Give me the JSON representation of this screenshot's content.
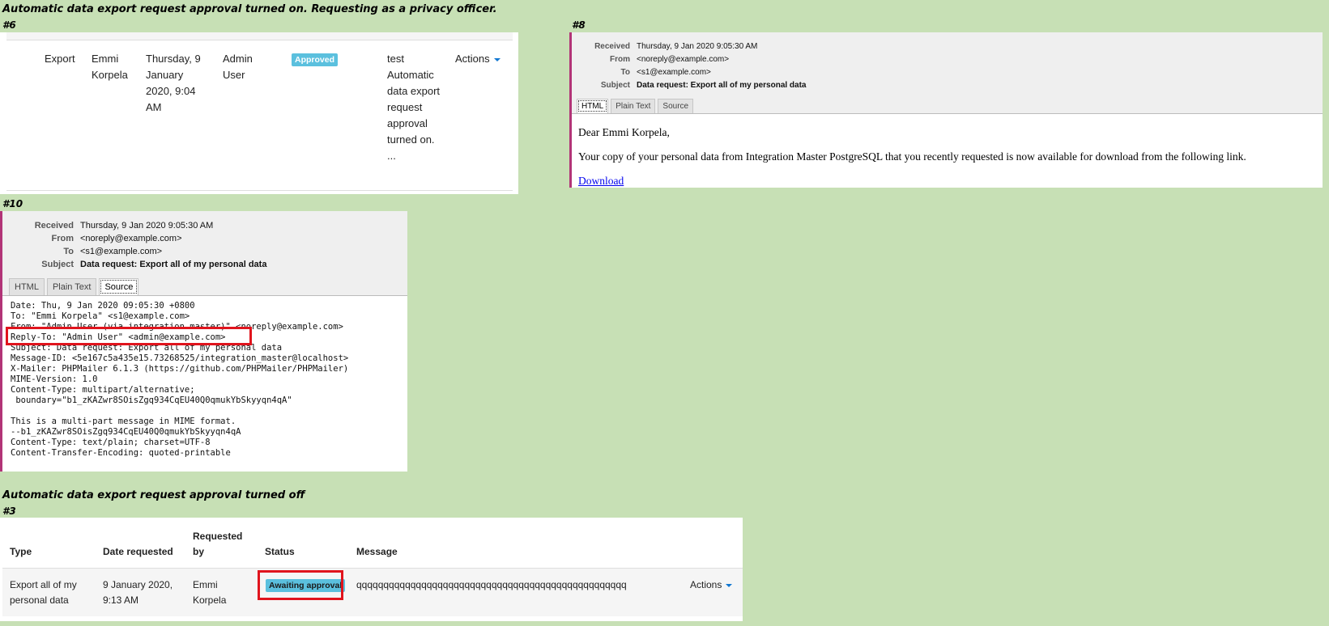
{
  "captions": {
    "top": "Automatic data export request approval turned on. Requesting as a privacy officer.",
    "bottom": "Automatic data export request approval turned off"
  },
  "labels": {
    "p6": "#6",
    "m8": "#8",
    "m10": "#10",
    "p3": "#3"
  },
  "panel6": {
    "type": "Export",
    "user": "Emmi Korpela",
    "date": "Thursday, 9 January 2020, 9:04 AM",
    "requested_by": "Admin User",
    "status": "Approved",
    "message": "test Automatic data export request approval turned on. ...",
    "actions": "Actions"
  },
  "mail8": {
    "header": [
      {
        "k": "Received",
        "v": "Thursday, 9 Jan 2020 9:05:30 AM"
      },
      {
        "k": "From",
        "v": "<noreply@example.com>"
      },
      {
        "k": "To",
        "v": "<s1@example.com>"
      },
      {
        "k": "Subject",
        "v": "Data request: Export all of my personal data"
      }
    ],
    "tabs": [
      "HTML",
      "Plain Text",
      "Source"
    ],
    "active_tab": "HTML",
    "greeting": "Dear Emmi Korpela,",
    "text": "Your copy of your personal data from Integration Master PostgreSQL that you recently requested is now available for download from the following link.",
    "link": "Download"
  },
  "mail10": {
    "header": [
      {
        "k": "Received",
        "v": "Thursday, 9 Jan 2020 9:05:30 AM"
      },
      {
        "k": "From",
        "v": "<noreply@example.com>"
      },
      {
        "k": "To",
        "v": "<s1@example.com>"
      },
      {
        "k": "Subject",
        "v": "Data request: Export all of my personal data"
      }
    ],
    "tabs": [
      "HTML",
      "Plain Text",
      "Source"
    ],
    "active_tab": "Source",
    "source": "Date: Thu, 9 Jan 2020 09:05:30 +0800\nTo: \"Emmi Korpela\" <s1@example.com>\nFrom: \"Admin User (via integration master)\" <noreply@example.com>\nReply-To: \"Admin User\" <admin@example.com>\nSubject: Data request: Export all of my personal data\nMessage-ID: <5e167c5a435e15.73268525/integration_master@localhost>\nX-Mailer: PHPMailer 6.1.3 (https://github.com/PHPMailer/PHPMailer)\nMIME-Version: 1.0\nContent-Type: multipart/alternative;\n boundary=\"b1_zKAZwr8SOisZgq934CqEU40Q0qmukYbSkyyqn4qA\"\n\nThis is a multi-part message in MIME format.\n--b1_zKAZwr8SOisZgq934CqEU40Q0qmukYbSkyyqn4qA\nContent-Type: text/plain; charset=UTF-8\nContent-Transfer-Encoding: quoted-printable"
  },
  "panel3": {
    "headers": {
      "type": "Type",
      "date": "Date requested",
      "requested_by": "Requested by",
      "status": "Status",
      "message": "Message"
    },
    "row": {
      "type": "Export all of my personal data",
      "date": "9 January 2020, 9:13 AM",
      "requested_by": "Emmi Korpela",
      "status": "Awaiting approval",
      "message": "qqqqqqqqqqqqqqqqqqqqqqqqqqqqqqqqqqqqqqqqqqqqqqqqqq",
      "actions": "Actions"
    }
  },
  "colors": {
    "background": "#c7e0b5",
    "link": "#1177d1",
    "badge": "#5bc0de",
    "highlight": "#e0141d",
    "mail_border": "#b23477"
  }
}
